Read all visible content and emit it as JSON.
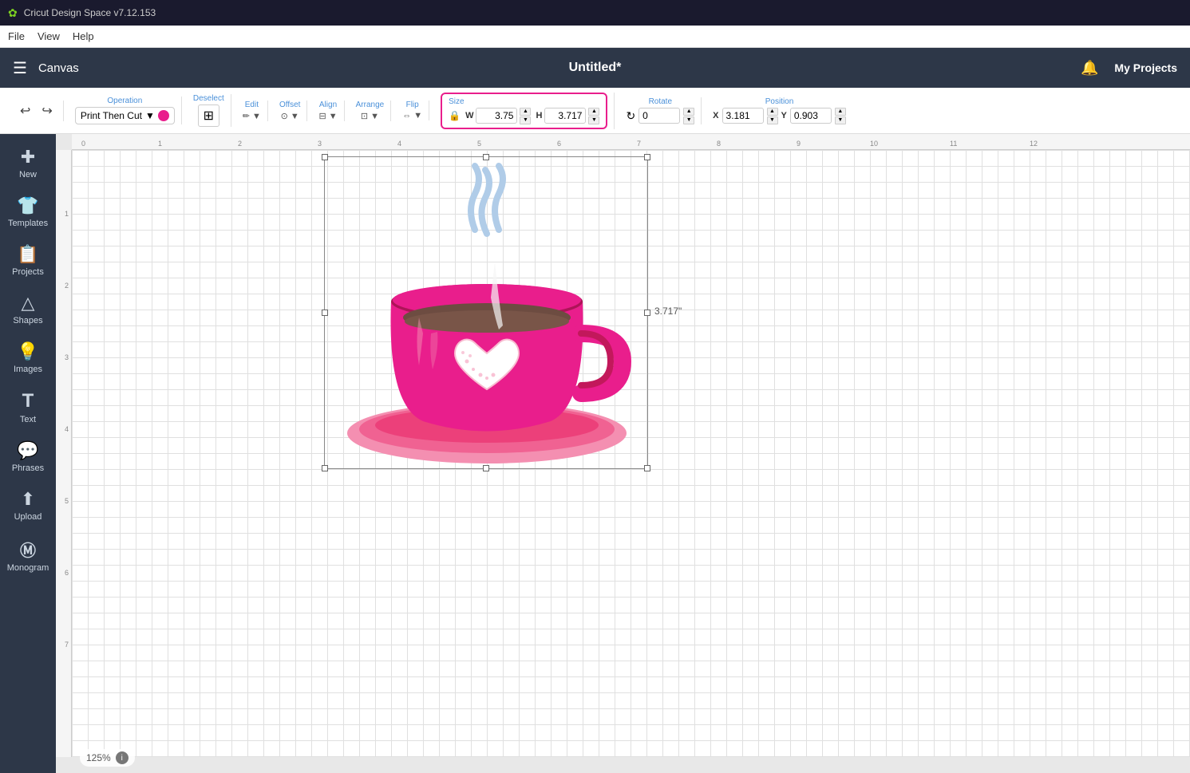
{
  "titlebar": {
    "icon": "✿",
    "title": "Cricut Design Space  v7.12.153"
  },
  "menubar": {
    "items": [
      "File",
      "View",
      "Help"
    ]
  },
  "header": {
    "hamburger": "☰",
    "canvas_label": "Canvas",
    "title": "Untitled*",
    "bell_label": "🔔",
    "my_projects_label": "My Projects"
  },
  "toolbar": {
    "operation_label": "Operation",
    "operation_value": "Print Then Cut",
    "deselect_label": "Deselect",
    "edit_label": "Edit",
    "offset_label": "Offset",
    "align_label": "Align",
    "arrange_label": "Arrange",
    "flip_label": "Flip",
    "size_label": "Size",
    "size_w_label": "W",
    "size_w_value": "3.75",
    "size_h_label": "H",
    "size_h_value": "3.717",
    "rotate_label": "Rotate",
    "rotate_value": "0",
    "position_label": "Position",
    "position_x_label": "X",
    "position_x_value": "3.181",
    "position_y_label": "Y",
    "position_y_value": "0.903"
  },
  "sidebar": {
    "items": [
      {
        "id": "new",
        "icon": "✚",
        "label": "New"
      },
      {
        "id": "templates",
        "icon": "👕",
        "label": "Templates"
      },
      {
        "id": "projects",
        "icon": "📋",
        "label": "Projects"
      },
      {
        "id": "shapes",
        "icon": "△",
        "label": "Shapes"
      },
      {
        "id": "images",
        "icon": "💡",
        "label": "Images"
      },
      {
        "id": "text",
        "icon": "T",
        "label": "Text"
      },
      {
        "id": "phrases",
        "icon": "💬",
        "label": "Phrases"
      },
      {
        "id": "upload",
        "icon": "⬆",
        "label": "Upload"
      },
      {
        "id": "monogram",
        "icon": "M",
        "label": "Monogram"
      }
    ]
  },
  "canvas": {
    "zoom_value": "125%",
    "size_dimension_label": "3.717\""
  },
  "ruler": {
    "h_marks": [
      "0",
      "1",
      "2",
      "3",
      "4",
      "5",
      "6",
      "7",
      "8",
      "9",
      "10",
      "11",
      "12"
    ],
    "v_marks": [
      "1",
      "2",
      "3",
      "4",
      "5",
      "6",
      "7"
    ]
  }
}
